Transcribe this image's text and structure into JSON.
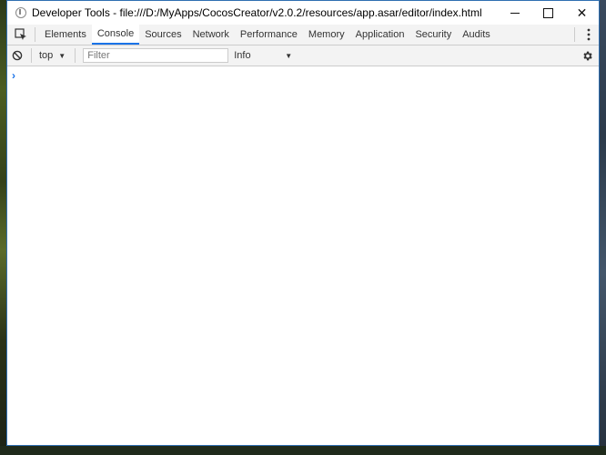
{
  "window": {
    "title": "Developer Tools - file:///D:/MyApps/CocosCreator/v2.0.2/resources/app.asar/editor/index.html",
    "close_glyph": "✕"
  },
  "tabs": [
    {
      "label": "Elements",
      "active": false
    },
    {
      "label": "Console",
      "active": true
    },
    {
      "label": "Sources",
      "active": false
    },
    {
      "label": "Network",
      "active": false
    },
    {
      "label": "Performance",
      "active": false
    },
    {
      "label": "Memory",
      "active": false
    },
    {
      "label": "Application",
      "active": false
    },
    {
      "label": "Security",
      "active": false
    },
    {
      "label": "Audits",
      "active": false
    }
  ],
  "toolbar": {
    "context": "top",
    "filter_placeholder": "Filter",
    "level": "Info"
  },
  "console": {
    "prompt": "›"
  },
  "colors": {
    "accent": "#1a73e8",
    "window_border": "#2f6fb1"
  }
}
